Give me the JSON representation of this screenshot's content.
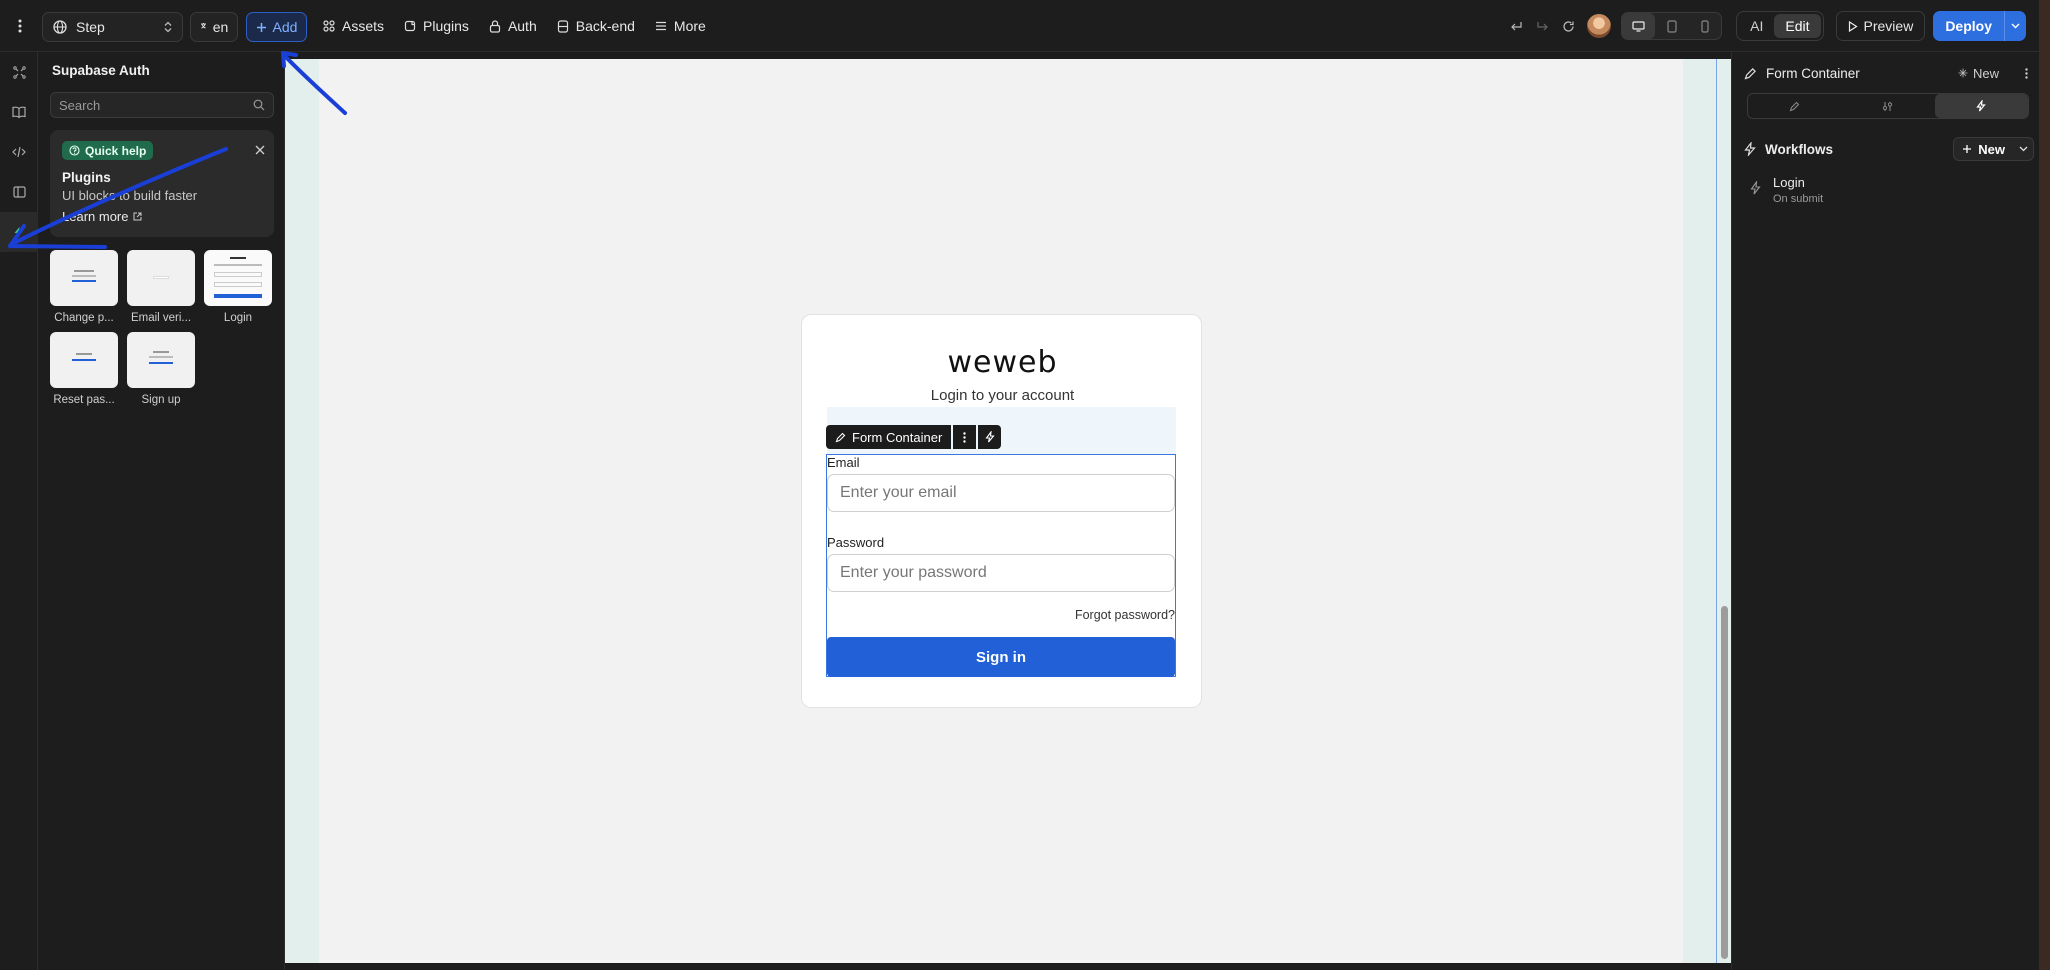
{
  "topbar": {
    "page_selector": "Step",
    "language": "en",
    "add_label": "Add",
    "nav": [
      {
        "label": "Assets",
        "icon": "assets-icon"
      },
      {
        "label": "Plugins",
        "icon": "plugin-icon"
      },
      {
        "label": "Auth",
        "icon": "lock-icon"
      },
      {
        "label": "Back-end",
        "icon": "database-icon"
      },
      {
        "label": "More",
        "icon": "menu-icon"
      }
    ],
    "modes": [
      "AI",
      "Edit"
    ],
    "active_mode": "Edit",
    "preview_label": "Preview",
    "deploy_label": "Deploy"
  },
  "left_panel": {
    "title": "Supabase Auth",
    "search_placeholder": "Search",
    "quick_help": {
      "badge": "Quick help",
      "heading": "Plugins",
      "subtitle": "UI blocks to build faster",
      "link": "Learn more"
    },
    "blocks": [
      {
        "label": "Change p..."
      },
      {
        "label": "Email veri..."
      },
      {
        "label": "Login"
      },
      {
        "label": "Reset pas..."
      },
      {
        "label": "Sign up"
      }
    ]
  },
  "canvas": {
    "logo": "weweb",
    "subtitle": "Login to your account",
    "form_container_label": "Form Container",
    "email_label": "Email",
    "email_placeholder": "Enter your email",
    "password_label": "Password",
    "password_placeholder": "Enter your password",
    "forgot_link": "Forgot password?",
    "signin_label": "Sign in"
  },
  "right_panel": {
    "title": "Form Container",
    "new_label": "New",
    "workflows_title": "Workflows",
    "workflows_new": "New",
    "workflow": {
      "name": "Login",
      "trigger": "On submit"
    }
  },
  "colors": {
    "accent": "#2e6fe0",
    "signin_button": "#2260d8",
    "quick_help_badge": "#1f6b4c",
    "annotation_arrow": "#1a3fd6"
  }
}
